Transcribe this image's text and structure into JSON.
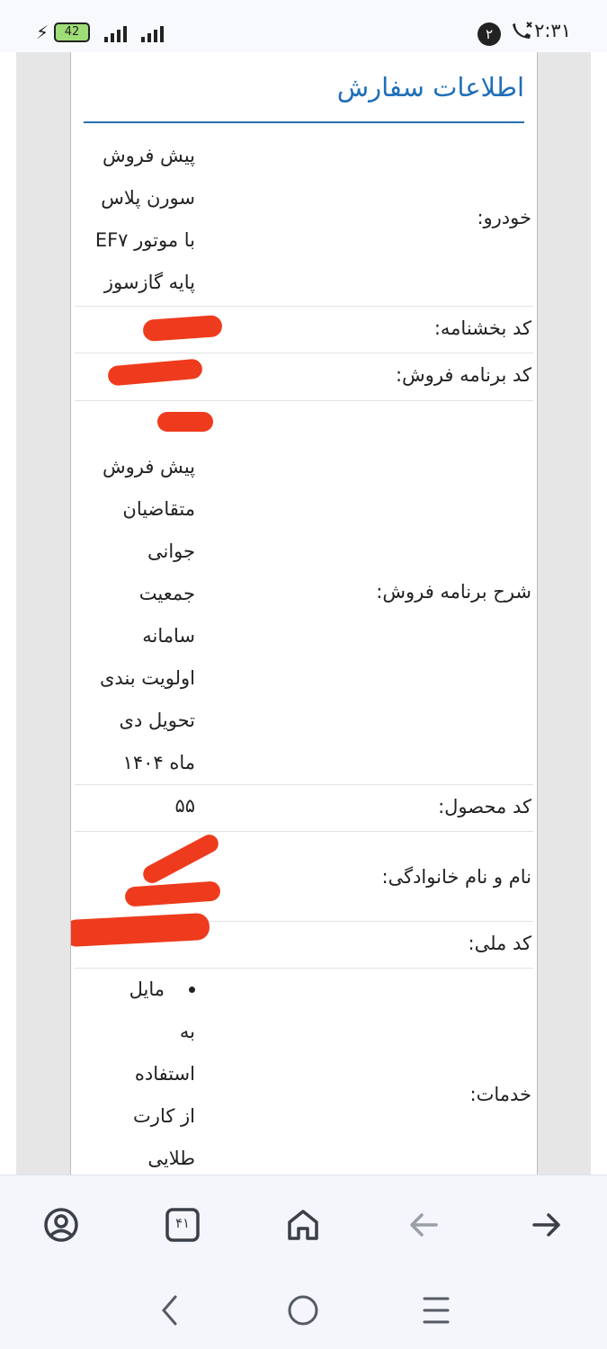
{
  "status_bar": {
    "time": "۲:۳۱",
    "notification_count": "۲",
    "battery": "42"
  },
  "card": {
    "title": "اطلاعات سفارش"
  },
  "rows": {
    "car": {
      "label": "خودرو:",
      "value_lines": [
        "پیش فروش",
        "سورن پلاس",
        "با موتور EF۷",
        "پایه گازسوز"
      ]
    },
    "circular_code": {
      "label": "کد بخشنامه:"
    },
    "sale_program_code": {
      "label": "کد برنامه فروش:"
    },
    "sale_program_description": {
      "label": "شرح برنامه فروش:",
      "value_lines": [
        "پیش فروش",
        "متقاضیان",
        "جوانی",
        "جمعیت",
        "سامانه",
        "اولویت بندی",
        "تحویل دی",
        "ماه ۱۴۰۴"
      ]
    },
    "product_code": {
      "label": "کد محصول:",
      "value": "۵۵"
    },
    "full_name": {
      "label": "نام و نام خانوادگی:"
    },
    "national_id": {
      "label": "کد ملی:"
    },
    "services": {
      "label": "خدمات:",
      "value_lines": [
        "مایل",
        "به",
        "استفاده",
        "از کارت",
        "طلایی"
      ]
    }
  },
  "browser_bar": {
    "tab_count": "۴۱"
  },
  "icons": {
    "profile": "profile-icon",
    "tabs": "tabs-icon",
    "home": "home-icon",
    "back": "back-arrow-icon",
    "forward": "forward-arrow-icon",
    "sys_back": "chevron-left-icon",
    "sys_home": "circle-home-icon",
    "sys_recents": "recents-icon"
  },
  "colors": {
    "title": "#1f6fb8",
    "redaction": "#ee3b1d"
  }
}
